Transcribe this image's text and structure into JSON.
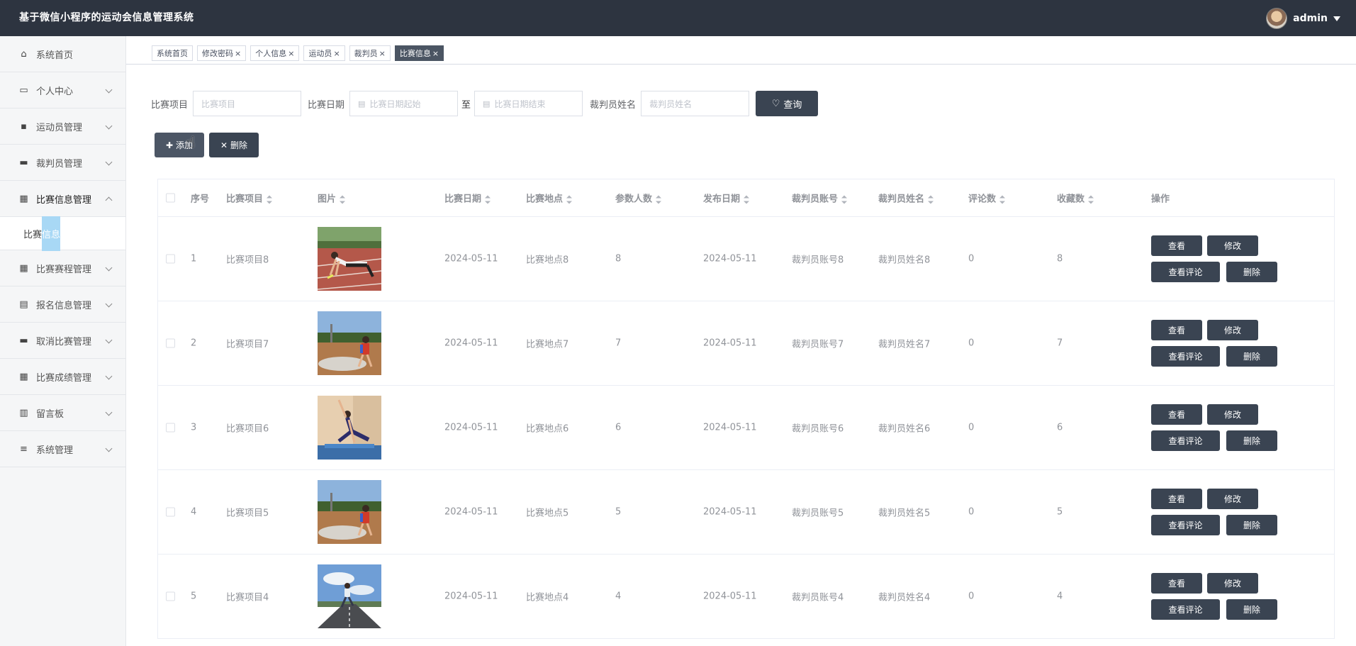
{
  "header": {
    "title": "基于微信小程序的运动会信息管理系统",
    "username": "admin"
  },
  "sidebar": {
    "items": [
      {
        "label": "系统首页",
        "icon": "home-icon",
        "glyph": "⌂",
        "has_children": false
      },
      {
        "label": "个人中心",
        "icon": "card-icon",
        "glyph": "▭",
        "has_children": true
      },
      {
        "label": "运动员管理",
        "icon": "chat-icon",
        "glyph": "▪",
        "has_children": true
      },
      {
        "label": "裁判员管理",
        "icon": "briefcase-icon",
        "glyph": "▬",
        "has_children": true
      },
      {
        "label": "比赛信息管理",
        "icon": "grid-icon",
        "glyph": "▦",
        "has_children": true,
        "open": true
      },
      {
        "label": "比赛赛程管理",
        "icon": "grid9-icon",
        "glyph": "▦",
        "has_children": true
      },
      {
        "label": "报名信息管理",
        "icon": "clipboard-icon",
        "glyph": "▤",
        "has_children": true
      },
      {
        "label": "取消比赛管理",
        "icon": "monitor-icon",
        "glyph": "▬",
        "has_children": true
      },
      {
        "label": "比赛成绩管理",
        "icon": "grid-icon",
        "glyph": "▦",
        "has_children": true
      },
      {
        "label": "留言板",
        "icon": "bar-chart-icon",
        "glyph": "▥",
        "has_children": true
      },
      {
        "label": "系统管理",
        "icon": "list-icon",
        "glyph": "≡",
        "has_children": true
      }
    ],
    "submenu": {
      "label_prefix": "比赛",
      "label_highlight": "信息"
    }
  },
  "tabs": [
    {
      "label": "系统首页",
      "closable": false,
      "active": false
    },
    {
      "label": "修改密码",
      "closable": true,
      "active": false
    },
    {
      "label": "个人信息",
      "closable": true,
      "active": false
    },
    {
      "label": "运动员",
      "closable": true,
      "active": false
    },
    {
      "label": "裁判员",
      "closable": true,
      "active": false
    },
    {
      "label": "比赛信息",
      "closable": true,
      "active": true
    }
  ],
  "search": {
    "item_label": "比赛项目",
    "item_placeholder": "比赛项目",
    "date_label": "比赛日期",
    "date_start_placeholder": "比赛日期起始",
    "date_sep": "至",
    "date_end_placeholder": "比赛日期结束",
    "judge_label": "裁判员姓名",
    "judge_placeholder": "裁判员姓名",
    "query_button": "查询"
  },
  "actions": {
    "add": "添加",
    "delete": "删除"
  },
  "table": {
    "columns": [
      "序号",
      "比赛项目",
      "图片",
      "比赛日期",
      "比赛地点",
      "参数人数",
      "发布日期",
      "裁判员账号",
      "裁判员姓名",
      "评论数",
      "收藏数",
      "操作"
    ],
    "row_buttons": {
      "view": "查看",
      "edit": "修改",
      "comments": "查看评论",
      "delete": "删除"
    },
    "rows": [
      {
        "index": "1",
        "item": "比赛项目8",
        "image": "track-stretch",
        "date": "2024-05-11",
        "place": "比赛地点8",
        "count": "8",
        "pub_date": "2024-05-11",
        "judge_account": "裁判员账号8",
        "judge_name": "裁判员姓名8",
        "comments": "0",
        "favorites": "8"
      },
      {
        "index": "2",
        "item": "比赛项目7",
        "image": "stadium-runner",
        "date": "2024-05-11",
        "place": "比赛地点7",
        "count": "7",
        "pub_date": "2024-05-11",
        "judge_account": "裁判员账号7",
        "judge_name": "裁判员姓名7",
        "comments": "0",
        "favorites": "7"
      },
      {
        "index": "3",
        "item": "比赛项目6",
        "image": "yoga-pose",
        "date": "2024-05-11",
        "place": "比赛地点6",
        "count": "6",
        "pub_date": "2024-05-11",
        "judge_account": "裁判员账号6",
        "judge_name": "裁判员姓名6",
        "comments": "0",
        "favorites": "6"
      },
      {
        "index": "4",
        "item": "比赛项目5",
        "image": "stadium-runner",
        "date": "2024-05-11",
        "place": "比赛地点5",
        "count": "5",
        "pub_date": "2024-05-11",
        "judge_account": "裁判员账号5",
        "judge_name": "裁判员姓名5",
        "comments": "0",
        "favorites": "5"
      },
      {
        "index": "5",
        "item": "比赛项目4",
        "image": "road-runner",
        "date": "2024-05-11",
        "place": "比赛地点4",
        "count": "4",
        "pub_date": "2024-05-11",
        "judge_account": "裁判员账号4",
        "judge_name": "裁判员姓名4",
        "comments": "0",
        "favorites": "4"
      }
    ]
  }
}
